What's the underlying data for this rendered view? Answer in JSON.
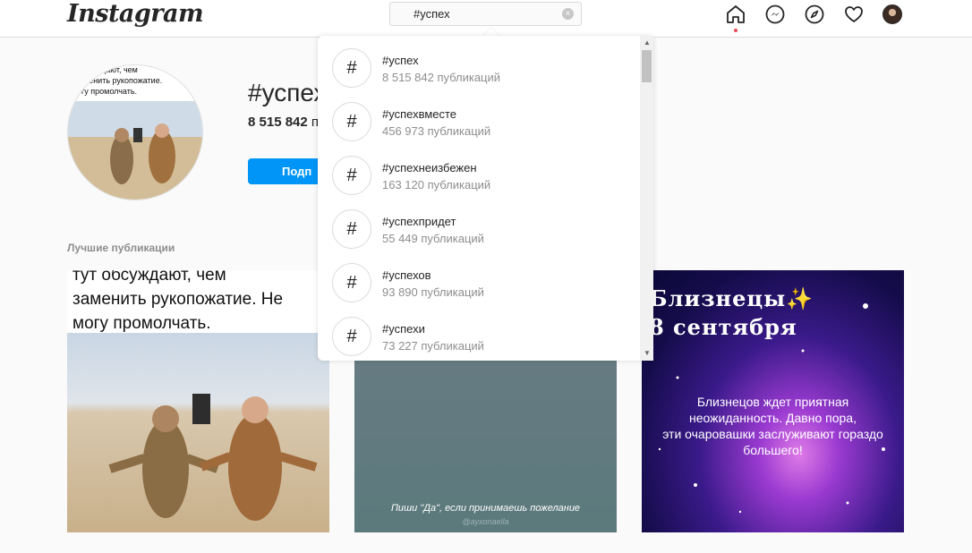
{
  "header": {
    "logo": "Instagram",
    "search_value": "#успех",
    "clear_label": "×"
  },
  "tag": {
    "title": "#успех",
    "count": "8 515 842",
    "count_suffix": "п",
    "follow_label": "Подп"
  },
  "profile_meme_lines": [
    "…ждают, чем",
    "…менить рукопожатие.",
    "огу промолчать."
  ],
  "section_label": "Лучшие публикации",
  "posts": {
    "p1_text": "тут обсуждают, чем\nзаменить рукопожатие. Не\nмогу промолчать.",
    "p2_caption": "Пиши \"Да\", если принимаешь пожелание",
    "p2_credit": "@ayxonaella",
    "p3_title_1": "Близнецы✨",
    "p3_title_2": "8 сентября",
    "p3_body": "Близнецов ждет приятная\nнеожиданность. Давно пора,\nэти очаровашки заслуживают гораздо\nбольшего!"
  },
  "results": [
    {
      "name": "#успех",
      "count": "8 515 842 публикаций"
    },
    {
      "name": "#успехвместе",
      "count": "456 973 публикаций"
    },
    {
      "name": "#успехнеизбежен",
      "count": "163 120 публикаций"
    },
    {
      "name": "#успехпридет",
      "count": "55 449 публикаций"
    },
    {
      "name": "#успехов",
      "count": "93 890 публикаций"
    },
    {
      "name": "#успехи",
      "count": "73 227 публикаций"
    }
  ],
  "hash_symbol": "#",
  "colors": {
    "primary_blue": "#0095f6",
    "notification_dot": "#ed4956"
  }
}
